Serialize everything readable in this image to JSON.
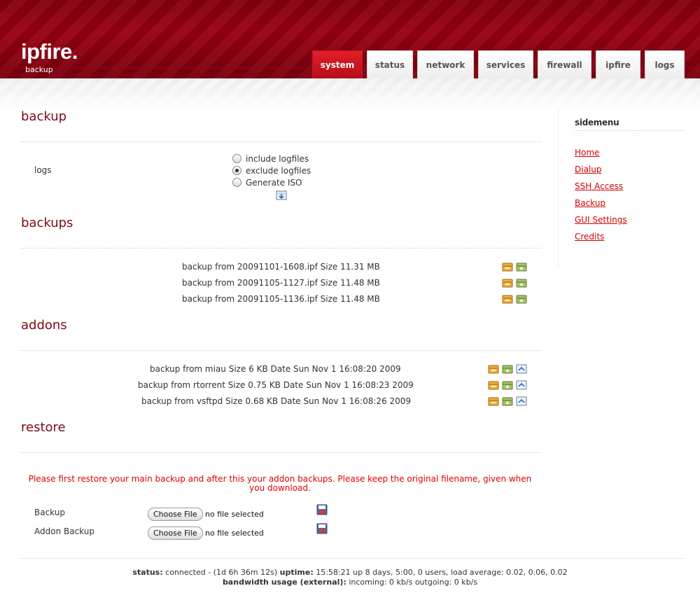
{
  "brand": {
    "logo": "ipfire.",
    "subtitle": "backup"
  },
  "nav": {
    "tabs": [
      "system",
      "status",
      "network",
      "services",
      "firewall",
      "ipfire",
      "logs"
    ],
    "active": "system"
  },
  "sections": {
    "backup": {
      "title": "backup",
      "logs_label": "logs",
      "options": [
        "include logfiles",
        "exclude logfiles",
        "Generate ISO"
      ],
      "selected": "exclude logfiles"
    },
    "backups": {
      "title": "backups",
      "rows": [
        "backup from 20091101-1608.ipf Size 11.31 MB",
        "backup from 20091105-1127.ipf Size 11.48 MB",
        "backup from 20091105-1136.ipf Size 11.48 MB"
      ]
    },
    "addons": {
      "title": "addons",
      "rows": [
        "backup from miau Size 6 KB Date Sun Nov 1 16:08:20 2009",
        "backup from rtorrent Size 0.75 KB Date Sun Nov 1 16:08:23 2009",
        "backup from vsftpd Size 0.68 KB Date Sun Nov 1 16:08:26 2009"
      ]
    },
    "restore": {
      "title": "restore",
      "warning": "Please first restore your main backup and after this your addon backups. Please keep the original filename, given when you download.",
      "backup_label": "Backup",
      "addon_label": "Addon Backup",
      "choose_file": "Choose File",
      "no_file": "no file selected"
    }
  },
  "sidemenu": {
    "title": "sidemenu",
    "items": [
      "Home",
      "Dialup",
      "SSH Access",
      "Backup",
      "GUI Settings",
      "Credits"
    ]
  },
  "footer": {
    "status_label": "status:",
    "status_value": "connected - (1d 6h 36m 12s)",
    "uptime_label": "uptime:",
    "uptime_value": "15:58:21 up 8 days, 5:00, 0 users, load average: 0.02, 0.06, 0.02",
    "bandwidth_label": "bandwidth usage (external):",
    "bandwidth_value": "incoming: 0 kb/s outgoing: 0 kb/s"
  },
  "colors": {
    "brand_red": "#8c0010",
    "accent_red": "#d00000",
    "heading": "#7a0b12"
  },
  "icons": {
    "download": "download-icon",
    "restore": "restore-icon",
    "delete": "delete-icon",
    "upload": "upload-icon",
    "save": "save-icon"
  }
}
